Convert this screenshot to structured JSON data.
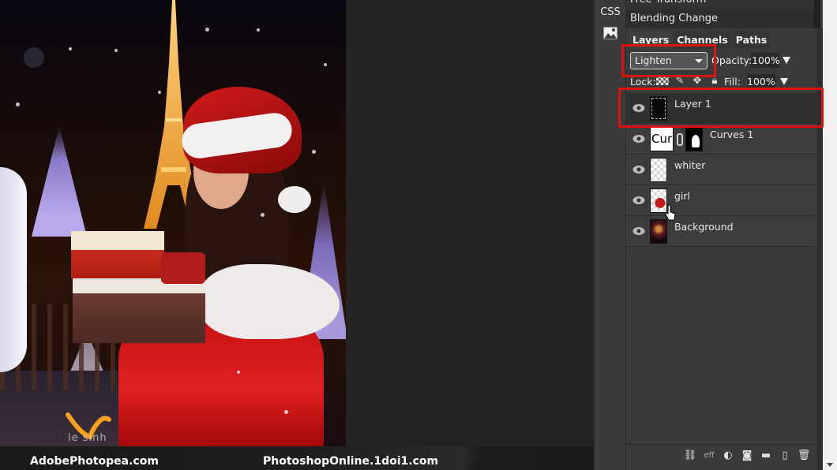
{
  "canvas": {
    "image_description": "Girl in Santa hat holding gift boxes in front of illuminated Eiffel Tower at night with snow",
    "watermark": "le sinh"
  },
  "captions": {
    "left": "AdobePhotopea.com",
    "right": "PhotoshopOnline.1doi1.com"
  },
  "tool_strip": {
    "items": [
      {
        "label": "CSS",
        "icon": "css-text"
      },
      {
        "label": "",
        "icon": "image-icon"
      }
    ]
  },
  "history": {
    "items": [
      {
        "label": "Free Transform"
      },
      {
        "label": "Blending Change",
        "active": true
      }
    ]
  },
  "layers_panel": {
    "tabs": [
      {
        "label": "Layers",
        "active": true
      },
      {
        "label": "Channels"
      },
      {
        "label": "Paths"
      }
    ],
    "blend_mode": "Lighten",
    "opacity_label": "Opacity:",
    "opacity_value": "100%",
    "lock_label": "Lock:",
    "fill_label": "Fill:",
    "fill_value": "100%",
    "layers": [
      {
        "name": "Layer 1",
        "visible": true,
        "selected": true,
        "thumb": "black"
      },
      {
        "name": "Curves 1",
        "visible": true,
        "thumb": "curves",
        "thumb_text": "Cur",
        "has_mask": true
      },
      {
        "name": "whiter",
        "visible": true,
        "thumb": "transparent"
      },
      {
        "name": "girl",
        "visible": true,
        "thumb": "girl"
      },
      {
        "name": "Background",
        "visible": true,
        "thumb": "background"
      }
    ],
    "bottom_icons": [
      "link-icon",
      "effects-icon",
      "adjustment-icon",
      "mask-icon",
      "folder-icon",
      "new-layer-icon",
      "trash-icon"
    ],
    "effects_label": "eff"
  },
  "colors": {
    "highlight": "#e01010",
    "panel_bg": "#3a3a3a",
    "workspace_bg": "#232323"
  }
}
